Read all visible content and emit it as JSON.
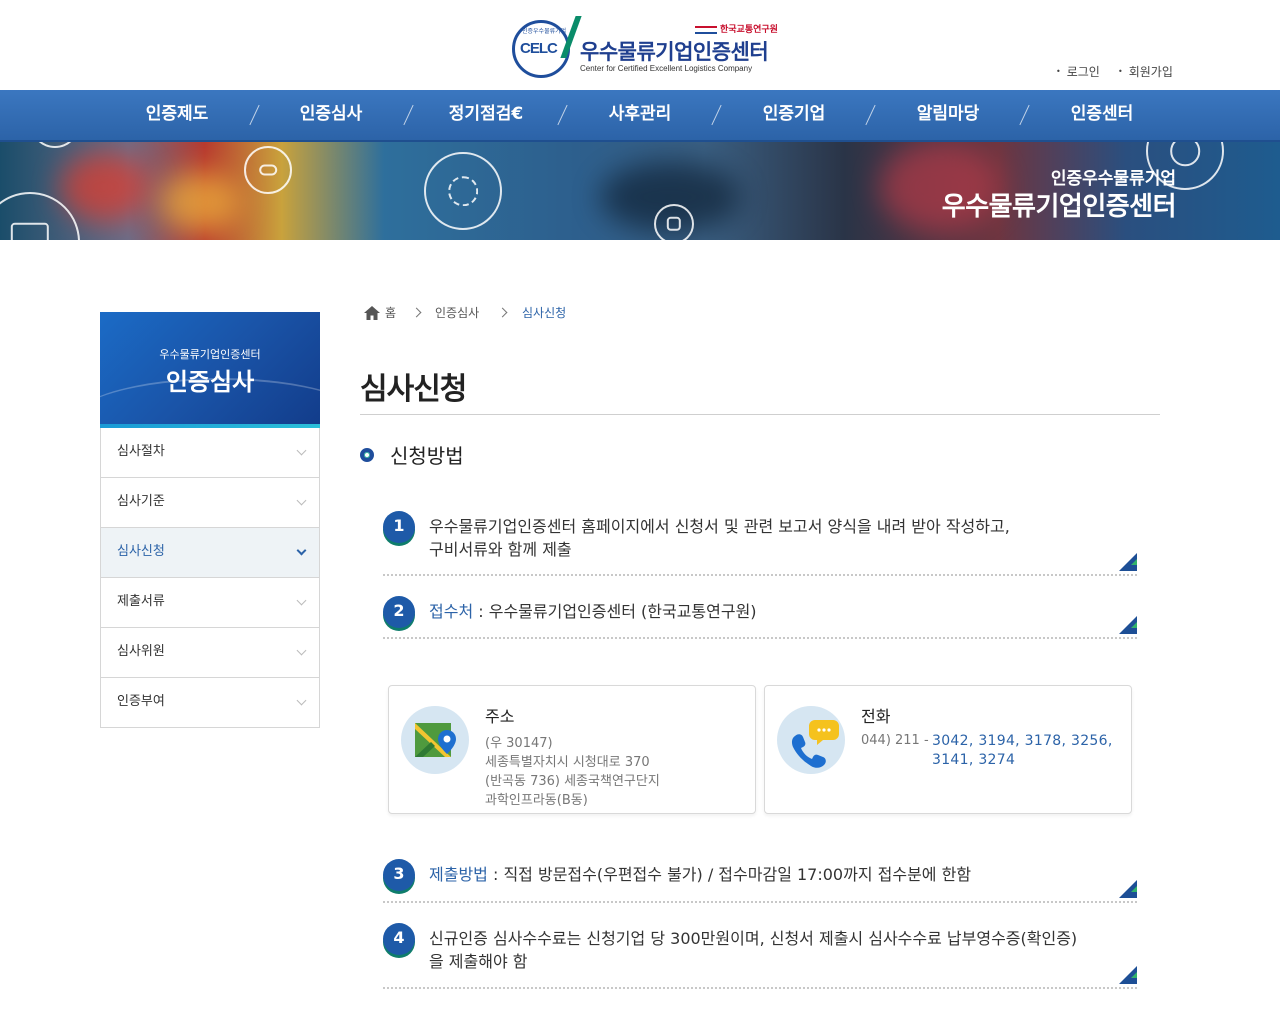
{
  "header": {
    "logo_badge": "CELC",
    "logo_ring_text": "인증우수물류기업",
    "logo_org": "한국교통연구원",
    "logo_name": "우수물류기업인증센터",
    "logo_sub": "Center for Certified Excellent Logistics Company",
    "login": "로그인",
    "signup": "회원가입"
  },
  "nav": [
    {
      "label": "인증제도"
    },
    {
      "label": "인증심사"
    },
    {
      "label": "정기점검€"
    },
    {
      "label": "사후관리"
    },
    {
      "label": "인증기업"
    },
    {
      "label": "알림마당"
    },
    {
      "label": "인증센터"
    }
  ],
  "banner": {
    "kicker": "인증우수물류기업",
    "title": "우수물류기업인증센터"
  },
  "sidebar": {
    "subtitle": "우수물류기업인증센터",
    "title": "인증심사",
    "items": [
      {
        "label": "심사절차"
      },
      {
        "label": "심사기준"
      },
      {
        "label": "심사신청"
      },
      {
        "label": "제출서류"
      },
      {
        "label": "심사위원"
      },
      {
        "label": "인증부여"
      }
    ],
    "active": "심사신청"
  },
  "breadcrumb": [
    "홈",
    "인증심사",
    "심사신청"
  ],
  "page_title": "심사신청",
  "section_title": "신청방법",
  "steps": [
    {
      "num": "1",
      "line1": "우수물류기업인증센터 홈페이지에서 신청서 및 관련 보고서 양식을 내려 받아 작성하고,",
      "line2": "구비서류와 함께 제출"
    },
    {
      "num": "2",
      "highlight": "접수처",
      "text": " : 우수물류기업인증센터 (한국교통연구원)"
    },
    {
      "num": "3",
      "highlight": "제출방법",
      "text": " : 직접 방문접수(우편접수 불가) / 접수마감일 17:00까지 접수분에 한함"
    },
    {
      "num": "4",
      "line1": "신규인증 심사수수료는 신청기업 당 300만원이며, 신청서 제출시 심사수수료 납부영수증(확인증)",
      "line2": "을 제출해야 함"
    }
  ],
  "cards": {
    "address": {
      "icon": "map-pin-icon",
      "title": "주소",
      "lines": [
        "(우 30147)",
        "세종특별자치시 시청대로 370",
        "(반곡동 736) 세종국책연구단지",
        "과학인프라동(B동)"
      ]
    },
    "phone": {
      "icon": "phone-chat-icon",
      "title": "전화",
      "prefix": "044) 211 -",
      "numbers_line1": "3042, 3194, 3178, 3256,",
      "numbers_line2": "3141, 3274"
    }
  },
  "colors": {
    "nav_blue": "#2c63a8",
    "accent_blue": "#1e5aa8",
    "accent_green": "#0f7d6b"
  }
}
